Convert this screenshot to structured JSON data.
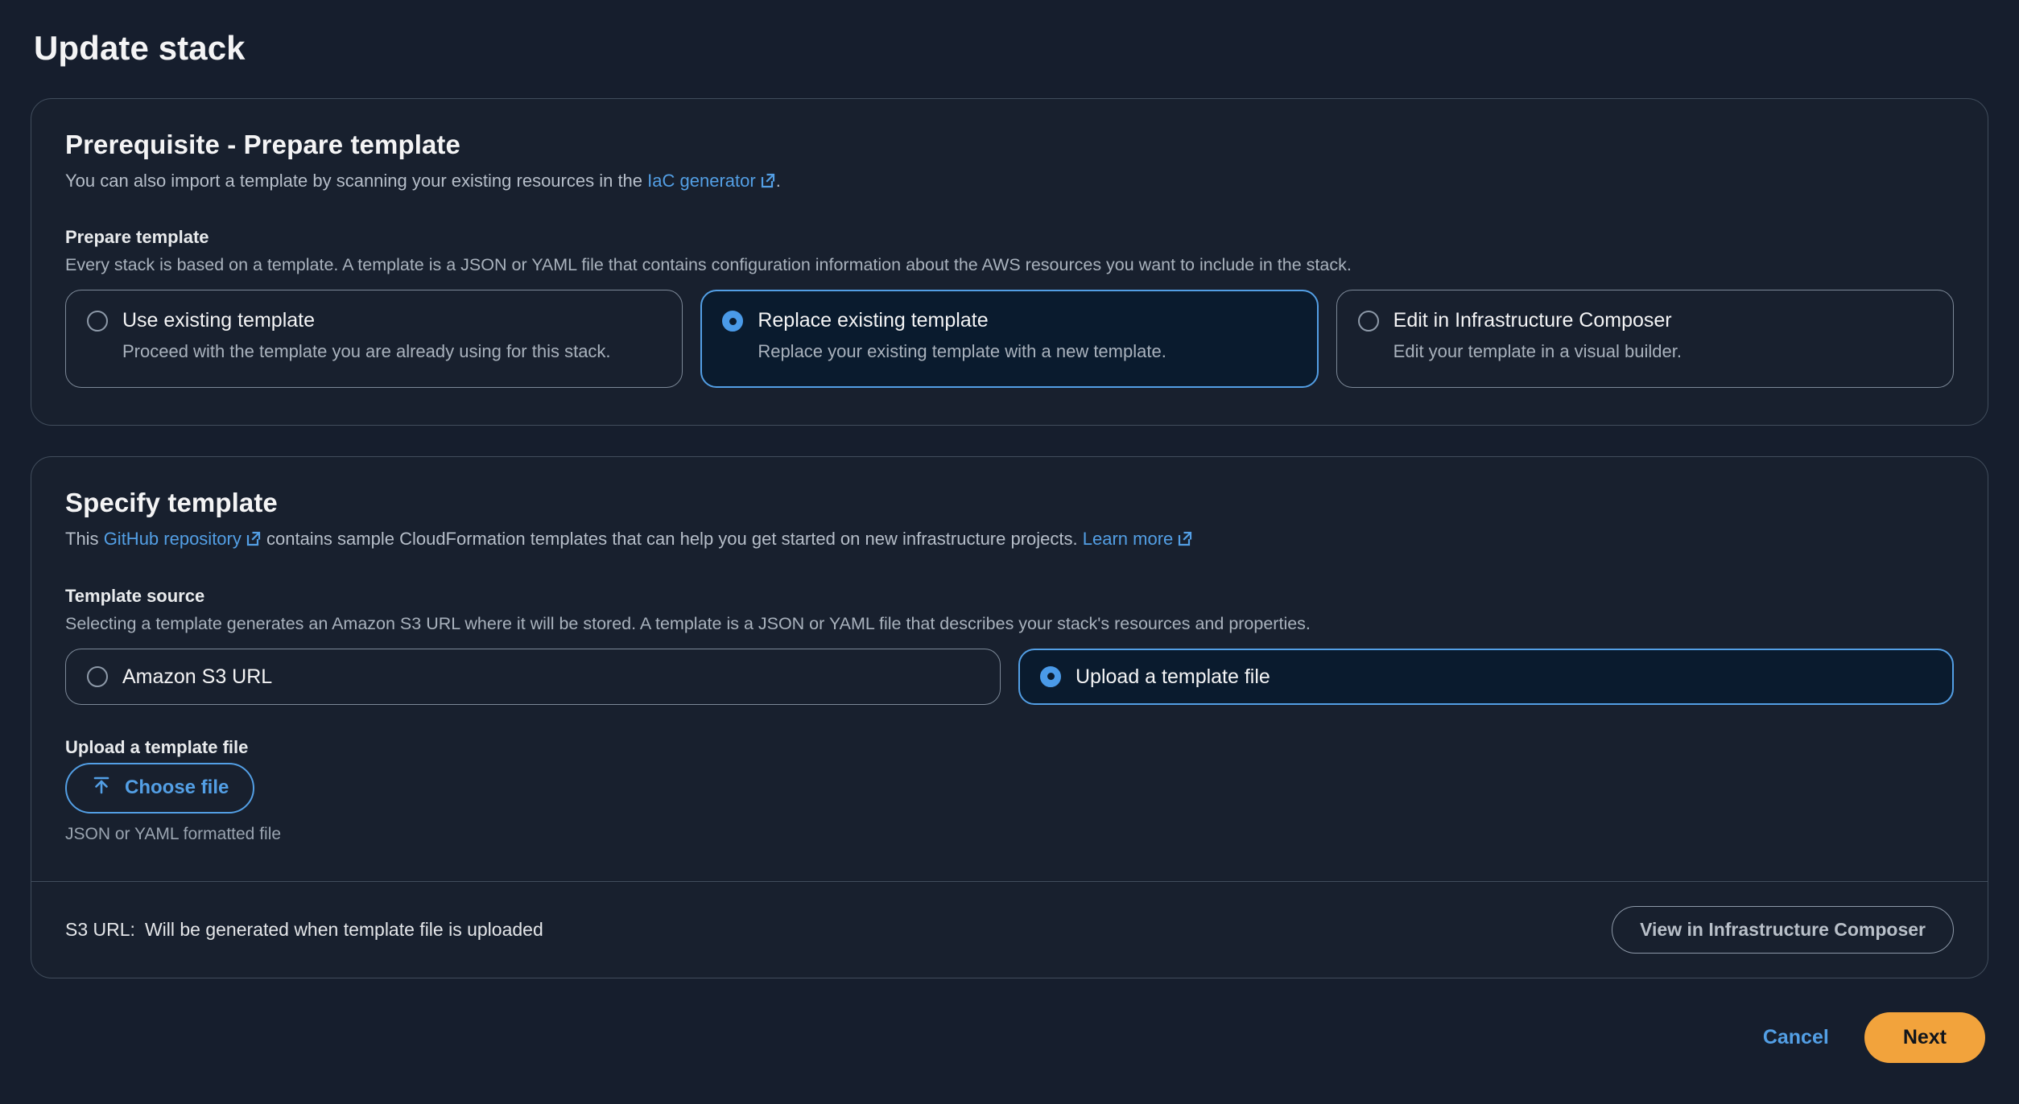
{
  "page": {
    "title": "Update stack"
  },
  "prerequisite": {
    "heading": "Prerequisite - Prepare template",
    "description_before": "You can also import a template by scanning your existing resources in the ",
    "link_label": "IaC generator",
    "description_after": ".",
    "field_label": "Prepare template",
    "field_description": "Every stack is based on a template. A template is a JSON or YAML file that contains configuration information about the AWS resources you want to include in the stack.",
    "options": [
      {
        "title": "Use existing template",
        "description": "Proceed with the template you are already using for this stack.",
        "selected": false
      },
      {
        "title": "Replace existing template",
        "description": "Replace your existing template with a new template.",
        "selected": true
      },
      {
        "title": "Edit in Infrastructure Composer",
        "description": "Edit your template in a visual builder.",
        "selected": false
      }
    ]
  },
  "specify": {
    "heading": "Specify template",
    "desc_part1": "This ",
    "github_link_label": "GitHub repository",
    "desc_part2": " contains sample CloudFormation templates that can help you get started on new infrastructure projects. ",
    "learn_more_label": "Learn more",
    "source_label": "Template source",
    "source_description": "Selecting a template generates an Amazon S3 URL where it will be stored. A template is a JSON or YAML file that describes your stack's resources and properties.",
    "source_options": [
      {
        "title": "Amazon S3 URL",
        "selected": false
      },
      {
        "title": "Upload a template file",
        "selected": true
      }
    ],
    "upload_label": "Upload a template file",
    "choose_file_label": "Choose file",
    "file_hint": "JSON or YAML formatted file",
    "s3_url_label": "S3 URL:",
    "s3_url_value": "Will be generated when template file is uploaded",
    "view_composer_label": "View in Infrastructure Composer"
  },
  "actions": {
    "cancel_label": "Cancel",
    "next_label": "Next"
  },
  "colors": {
    "accent_blue": "#539FE5",
    "primary_orange": "#F2A33C",
    "page_background": "#161E2D",
    "card_background": "#18202E",
    "selected_card_background": "#0A1B2E",
    "border": "#414D5C"
  }
}
